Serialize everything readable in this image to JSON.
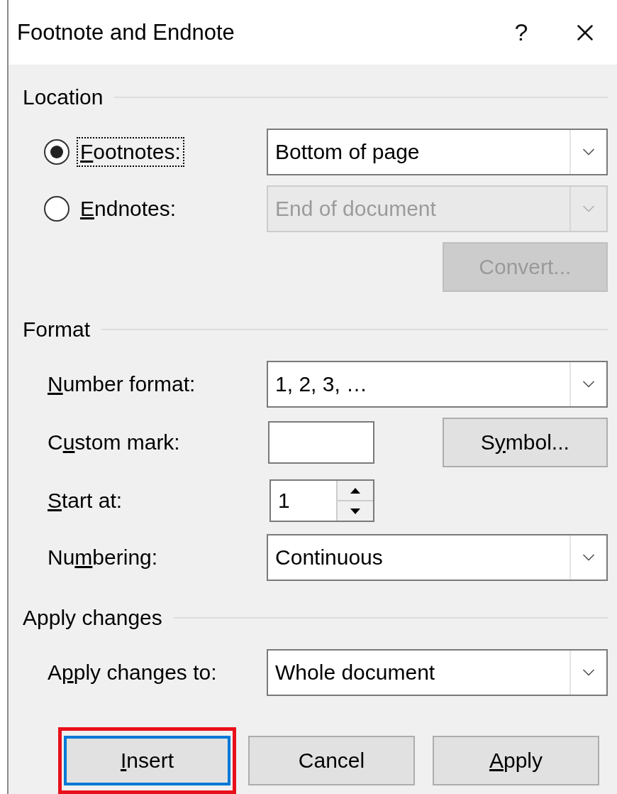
{
  "window": {
    "title": "Footnote and Endnote",
    "help": "?"
  },
  "sections": [
    {
      "title": "Location",
      "rows": [
        {
          "kind": "radio",
          "selected": true,
          "focused": true,
          "label": {
            "key": "F",
            "post": "ootnotes:"
          },
          "dropdown": {
            "value": "Bottom of page",
            "disabled": false
          }
        },
        {
          "kind": "radio",
          "selected": false,
          "focused": false,
          "label": {
            "key": "E",
            "post": "ndnotes:"
          },
          "dropdown": {
            "value": "End of document",
            "disabled": true
          }
        },
        {
          "kind": "button",
          "button": {
            "label": {
              "pre": "Convert..."
            },
            "disabled": true
          }
        }
      ]
    },
    {
      "title": "Format",
      "rows": [
        {
          "kind": "dropdown",
          "label": {
            "key": "N",
            "post": "umber format:"
          },
          "dropdown": {
            "value": "1, 2, 3, …",
            "disabled": false
          }
        },
        {
          "kind": "custom",
          "label": {
            "pre": "C",
            "key": "u",
            "post": "stom mark:"
          },
          "button": {
            "label": {
              "pre": "S",
              "key": "y",
              "post": "mbol..."
            },
            "disabled": false
          }
        },
        {
          "kind": "spinner",
          "label": {
            "key": "S",
            "post": "tart at:"
          },
          "value": "1"
        },
        {
          "kind": "dropdown",
          "label": {
            "pre": "Nu",
            "key": "m",
            "post": "bering:"
          },
          "dropdown": {
            "value": "Continuous",
            "disabled": false
          }
        }
      ]
    },
    {
      "title": "Apply changes",
      "rows": [
        {
          "kind": "dropdown",
          "label": {
            "pre": "A",
            "key": "p",
            "post": "ply changes to:"
          },
          "dropdown": {
            "value": "Whole document",
            "disabled": false
          }
        }
      ]
    }
  ],
  "buttons": [
    {
      "label": {
        "key": "I",
        "post": "nsert"
      },
      "default": true,
      "highlighted": true
    },
    {
      "label": {
        "pre": "Cancel"
      },
      "default": false,
      "highlighted": false
    },
    {
      "label": {
        "key": "A",
        "post": "pply"
      },
      "default": false,
      "highlighted": false
    }
  ]
}
